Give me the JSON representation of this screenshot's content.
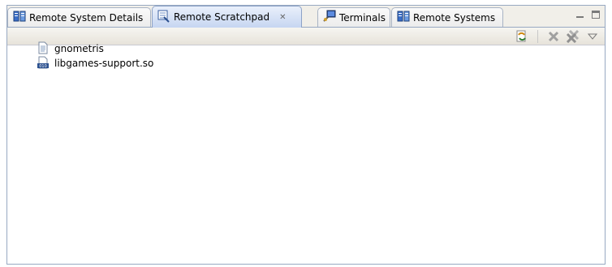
{
  "tabs": [
    {
      "label": "Remote System Details",
      "icon": "remote-systems-icon"
    },
    {
      "label": "Remote Scratchpad",
      "icon": "scratchpad-icon",
      "active": true,
      "closable": true
    },
    {
      "label": "Terminals",
      "icon": "terminal-icon"
    },
    {
      "label": "Remote Systems",
      "icon": "remote-systems-icon"
    }
  ],
  "tree": [
    {
      "label": "gnometris",
      "icon": "text-file-icon"
    },
    {
      "label": "libgames-support.so",
      "icon": "binary-file-icon"
    }
  ],
  "toolbar": [
    "refresh-icon",
    "remove-icon",
    "remove-all-icon",
    "view-menu-icon"
  ],
  "colors": {
    "active_tab": "#c6d6f1",
    "border": "#98a9c2",
    "toolbar_bg": "#ece9e2"
  }
}
